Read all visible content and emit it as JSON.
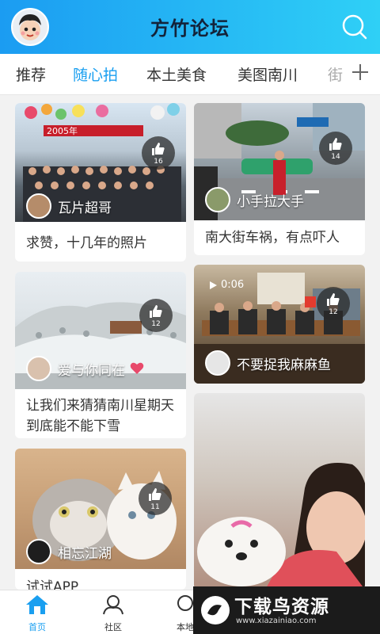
{
  "header": {
    "title": "方竹论坛"
  },
  "tabs": [
    "推荐",
    "随心拍",
    "本土美食",
    "美图南川",
    "街"
  ],
  "cards": [
    {
      "likes": "16",
      "author": "瓦片超哥",
      "caption": "求赞，十几年的照片",
      "banner": "2005年"
    },
    {
      "likes": "14",
      "author": "小手拉大手",
      "caption": "南大街车祸，有点吓人"
    },
    {
      "likes": "12",
      "author": "爱与你同在",
      "caption": "让我们来猜猜南川星期天到底能不能下雪"
    },
    {
      "likes": "12",
      "author": "不要捉我麻麻鱼",
      "caption": "",
      "video_time": "0:06"
    },
    {
      "likes": "11",
      "author": "相忘江湖",
      "caption": "试试APP"
    }
  ],
  "bottom_nav": [
    {
      "label": "首页"
    },
    {
      "label": "社区"
    },
    {
      "label": "本地"
    }
  ],
  "watermark": {
    "title": "下载鸟资源",
    "url": "www.xiazainiao.com"
  },
  "colors": {
    "accent": "#1a9ff0"
  }
}
